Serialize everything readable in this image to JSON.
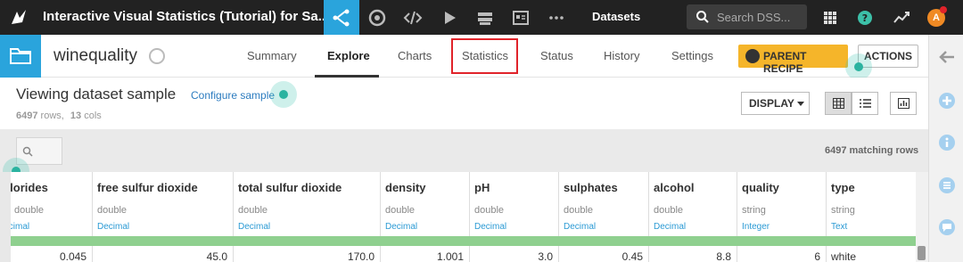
{
  "topnav": {
    "title": "Interactive Visual Statistics (Tutorial) for Sa...",
    "datasets_label": "Datasets",
    "search_placeholder": "Search DSS...",
    "avatar_letter": "A",
    "icons": [
      "flow-icon",
      "recipe-icon",
      "code-icon",
      "play-icon",
      "deploy-icon",
      "dashboard-icon",
      "more-icon",
      "apps-grid-icon",
      "help-icon",
      "activity-icon"
    ]
  },
  "dataset": {
    "name": "winequality",
    "tabs": [
      "Summary",
      "Explore",
      "Charts",
      "Statistics",
      "Status",
      "History",
      "Settings"
    ],
    "active_tab": "Explore",
    "highlighted_tab": "Statistics",
    "parent_recipe_label": "PARENT RECIPE",
    "actions_label": "ACTIONS"
  },
  "sample": {
    "title": "Viewing dataset sample",
    "configure_label": "Configure sample",
    "rows_count": "6497",
    "rows_label": "rows,",
    "cols_count": "13",
    "cols_label": "cols",
    "display_label": "DISPLAY"
  },
  "filter": {
    "matching_rows": "6497 matching rows"
  },
  "table": {
    "columns": [
      {
        "name": "chlorides",
        "type": "double",
        "meaning": "Decimal",
        "value": "0.045"
      },
      {
        "name": "free sulfur dioxide",
        "type": "double",
        "meaning": "Decimal",
        "value": "45.0"
      },
      {
        "name": "total sulfur dioxide",
        "type": "double",
        "meaning": "Decimal",
        "value": "170.0"
      },
      {
        "name": "density",
        "type": "double",
        "meaning": "Decimal",
        "value": "1.001"
      },
      {
        "name": "pH",
        "type": "double",
        "meaning": "Decimal",
        "value": "3.0"
      },
      {
        "name": "sulphates",
        "type": "double",
        "meaning": "Decimal",
        "value": "0.45"
      },
      {
        "name": "alcohol",
        "type": "double",
        "meaning": "Decimal",
        "value": "8.8"
      },
      {
        "name": "quality",
        "type": "string",
        "meaning": "Integer",
        "value": "6"
      },
      {
        "name": "type",
        "type": "string",
        "meaning": "Text",
        "value": "white"
      }
    ]
  },
  "colors": {
    "topnav_bg": "#222222",
    "accent_blue": "#2aa4dc",
    "parent_recipe": "#f5b52a",
    "highlight_red": "#e0232a",
    "quality_bar": "#8fd08f",
    "pulse": "#2bb3a0"
  }
}
